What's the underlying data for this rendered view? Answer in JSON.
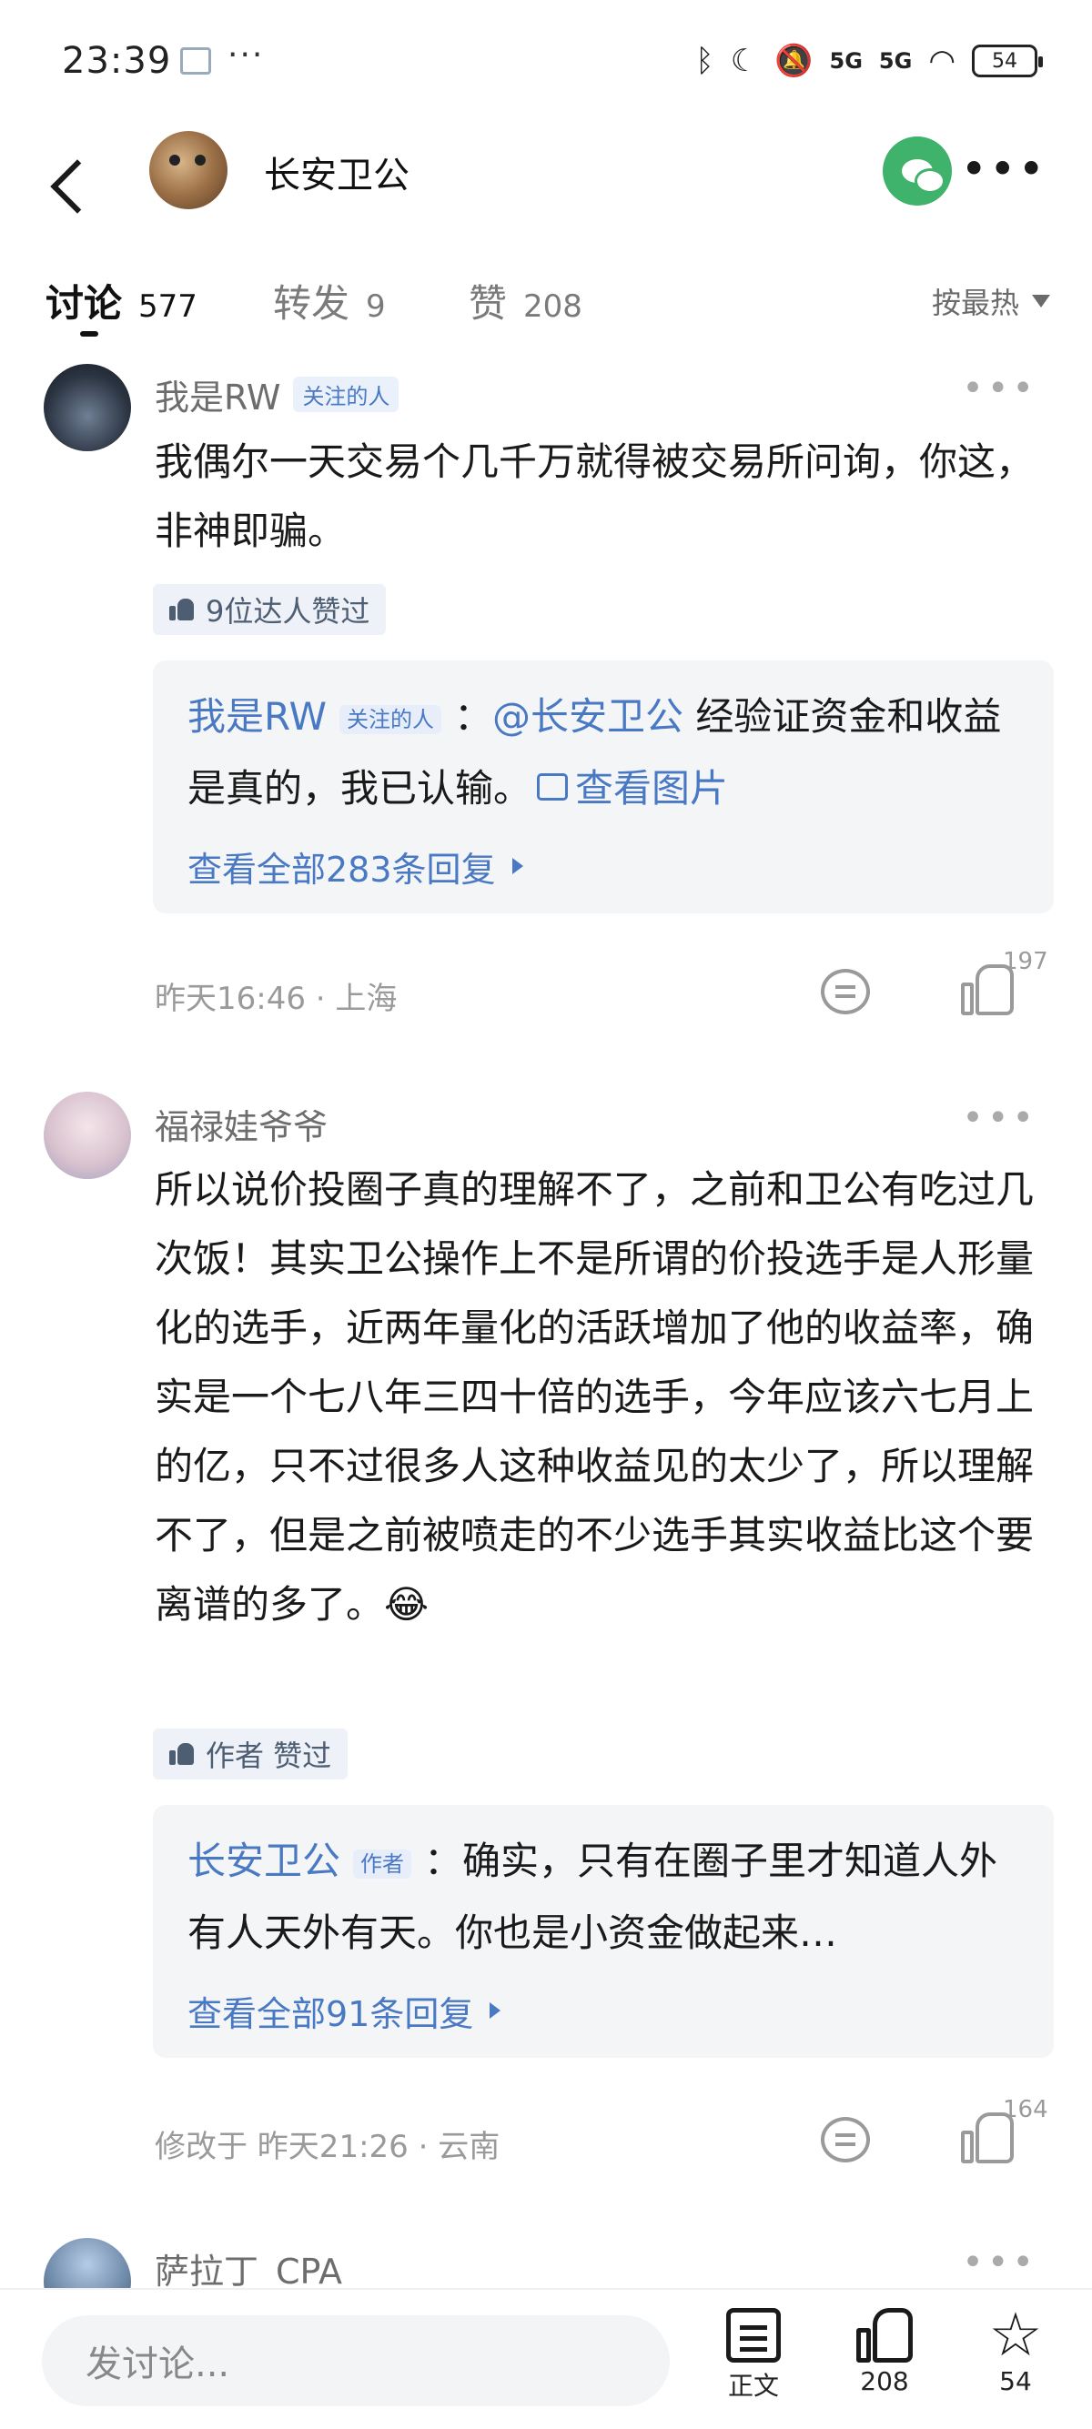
{
  "status_bar": {
    "time": "23:39",
    "dots": "···",
    "signal_a": "5G",
    "signal_b": "5G",
    "battery": "54"
  },
  "header": {
    "title": "长安卫公"
  },
  "tabs": [
    {
      "label": "讨论",
      "count": "577"
    },
    {
      "label": "转发",
      "count": "9"
    },
    {
      "label": "赞",
      "count": "208"
    }
  ],
  "sort": {
    "label": "按最热"
  },
  "comments": [
    {
      "user": "我是RW",
      "tag": "关注的人",
      "text": "我偶尔一天交易个几千万就得被交易所问询，你这，非神即骗。",
      "likers": "9位达人赞过",
      "reply": {
        "user": "我是RW",
        "tag": "关注的人",
        "colon": "：",
        "mention": "@长安卫公",
        "text": " 经验证资金和收益是真的，我已认输。",
        "image_link": "查看图片",
        "view_all": "查看全部283条回复"
      },
      "time": "昨天16:46 · 上海",
      "likes": "197"
    },
    {
      "user": "福禄娃爷爷",
      "text": "所以说价投圈子真的理解不了，之前和卫公有吃过几次饭！其实卫公操作上不是所谓的价投选手是人形量化的选手，近两年量化的活跃增加了他的收益率，确实是一个七八年三四十倍的选手，今年应该六七月上的亿，只不过很多人这种收益见的太少了，所以理解不了，但是之前被喷走的不少选手其实收益比这个要离谱的多了。😂",
      "likers": "作者 赞过",
      "reply": {
        "user": "长安卫公",
        "tag": "作者",
        "text": "：确实，只有在圈子里才知道人外有人天外有天。你也是小资金做起来…",
        "view_all": "查看全部91条回复"
      },
      "time": "修改于 昨天21:26 · 云南",
      "likes": "164"
    },
    {
      "user": "萨拉丁_CPA"
    }
  ],
  "bottom": {
    "placeholder": "发讨论...",
    "doc_label": "正文",
    "like_count": "208",
    "fav_count": "54"
  }
}
